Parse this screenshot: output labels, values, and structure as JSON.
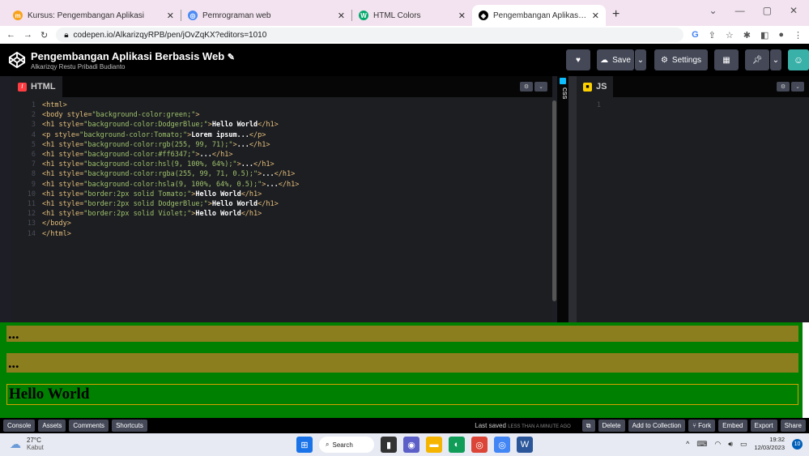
{
  "browser": {
    "tabs": [
      {
        "title": "Kursus: Pengembangan Aplikasi",
        "active": false
      },
      {
        "title": "Pemrograman web",
        "active": false
      },
      {
        "title": "HTML Colors",
        "active": false
      },
      {
        "title": "Pengembangan Aplikasi Berbasis",
        "active": true
      }
    ],
    "url": "codepen.io/AlkarizqyRPB/pen/jOvZqKX?editors=1010"
  },
  "codepen": {
    "title": "Pengembangan Aplikasi Berbasis Web",
    "edit_glyph": "✎",
    "author": "Alkarizqy Restu Pribadi Budianto",
    "save_label": "Save",
    "settings_label": "Settings"
  },
  "html_pane": {
    "label": "HTML",
    "lines": [
      {
        "n": "1",
        "parts": [
          [
            "tag",
            "<html>"
          ]
        ]
      },
      {
        "n": "2",
        "parts": [
          [
            "tag",
            "<body "
          ],
          [
            "attr",
            "style"
          ],
          [
            "tag",
            "="
          ],
          [
            "val",
            "\"background-color:green;\""
          ],
          [
            "tag",
            ">"
          ]
        ]
      },
      {
        "n": "3",
        "parts": [
          [
            "tag",
            "<h1 "
          ],
          [
            "attr",
            "style"
          ],
          [
            "tag",
            "="
          ],
          [
            "val",
            "\"background-color:DodgerBlue;\""
          ],
          [
            "tag",
            ">"
          ],
          [
            "txt",
            "Hello World"
          ],
          [
            "tag",
            "</h1>"
          ]
        ]
      },
      {
        "n": "4",
        "parts": [
          [
            "tag",
            "<p "
          ],
          [
            "attr",
            "style"
          ],
          [
            "tag",
            "="
          ],
          [
            "val",
            "\"background-color:Tomato;\""
          ],
          [
            "tag",
            ">"
          ],
          [
            "txt",
            "Lorem ipsum..."
          ],
          [
            "tag",
            "</p>"
          ]
        ]
      },
      {
        "n": "5",
        "parts": [
          [
            "tag",
            "<h1 "
          ],
          [
            "attr",
            "style"
          ],
          [
            "tag",
            "="
          ],
          [
            "val",
            "\"background-color:rgb(255, 99, 71);\""
          ],
          [
            "tag",
            ">"
          ],
          [
            "txt",
            "..."
          ],
          [
            "tag",
            "</h1>"
          ]
        ]
      },
      {
        "n": "6",
        "parts": [
          [
            "tag",
            "<h1 "
          ],
          [
            "attr",
            "style"
          ],
          [
            "tag",
            "="
          ],
          [
            "val",
            "\"background-color:#ff6347;\""
          ],
          [
            "tag",
            ">"
          ],
          [
            "txt",
            "..."
          ],
          [
            "tag",
            "</h1>"
          ]
        ]
      },
      {
        "n": "7",
        "parts": [
          [
            "tag",
            "<h1 "
          ],
          [
            "attr",
            "style"
          ],
          [
            "tag",
            "="
          ],
          [
            "val",
            "\"background-color:hsl(9, 100%, 64%);\""
          ],
          [
            "tag",
            ">"
          ],
          [
            "txt",
            "..."
          ],
          [
            "tag",
            "</h1>"
          ]
        ]
      },
      {
        "n": "8",
        "parts": [
          [
            "tag",
            "<h1 "
          ],
          [
            "attr",
            "style"
          ],
          [
            "tag",
            "="
          ],
          [
            "val",
            "\"background-color:rgba(255, 99, 71, 0.5);\""
          ],
          [
            "tag",
            ">"
          ],
          [
            "txt",
            "..."
          ],
          [
            "tag",
            "</h1>"
          ]
        ]
      },
      {
        "n": "9",
        "parts": [
          [
            "tag",
            "<h1 "
          ],
          [
            "attr",
            "style"
          ],
          [
            "tag",
            "="
          ],
          [
            "val",
            "\"background-color:hsla(9, 100%, 64%, 0.5);\""
          ],
          [
            "tag",
            ">"
          ],
          [
            "txt",
            "..."
          ],
          [
            "tag",
            "</h1>"
          ]
        ]
      },
      {
        "n": "10",
        "parts": [
          [
            "tag",
            "<h1 "
          ],
          [
            "attr",
            "style"
          ],
          [
            "tag",
            "="
          ],
          [
            "val",
            "\"border:2px solid Tomato;\""
          ],
          [
            "tag",
            ">"
          ],
          [
            "txt",
            "Hello World"
          ],
          [
            "tag",
            "</h1>"
          ]
        ]
      },
      {
        "n": "11",
        "parts": [
          [
            "tag",
            "<h1 "
          ],
          [
            "attr",
            "style"
          ],
          [
            "tag",
            "="
          ],
          [
            "val",
            "\"border:2px solid DodgerBlue;\""
          ],
          [
            "tag",
            ">"
          ],
          [
            "txt",
            "Hello World"
          ],
          [
            "tag",
            "</h1>"
          ]
        ]
      },
      {
        "n": "12",
        "parts": [
          [
            "tag",
            "<h1 "
          ],
          [
            "attr",
            "style"
          ],
          [
            "tag",
            "="
          ],
          [
            "val",
            "\"border:2px solid Violet;\""
          ],
          [
            "tag",
            ">"
          ],
          [
            "txt",
            "Hello World"
          ],
          [
            "tag",
            "</h1>"
          ]
        ]
      },
      {
        "n": "13",
        "parts": [
          [
            "tag",
            "</body>"
          ]
        ]
      },
      {
        "n": "14",
        "parts": [
          [
            "tag",
            "</html>"
          ]
        ]
      }
    ]
  },
  "css_label": "CSS",
  "js_pane": {
    "label": "JS",
    "line_number": "1"
  },
  "preview": {
    "rows": [
      "...",
      "..."
    ],
    "hello": "Hello World",
    "colors": {
      "bg": "#008000",
      "olive": "#8b7e1e",
      "border": "#d6a000"
    }
  },
  "bottom_bar": {
    "left": [
      "Console",
      "Assets",
      "Comments",
      "Shortcuts"
    ],
    "saved": "Last saved",
    "saved_when": "LESS THAN A MINUTE AGO",
    "right": [
      "Delete",
      "Add to Collection",
      "Fork",
      "Embed",
      "Export",
      "Share"
    ]
  },
  "taskbar": {
    "temp": "27°C",
    "weather": "Kabut",
    "search": "Search",
    "time": "19:32",
    "date": "12/03/2023",
    "notifications": "10"
  }
}
